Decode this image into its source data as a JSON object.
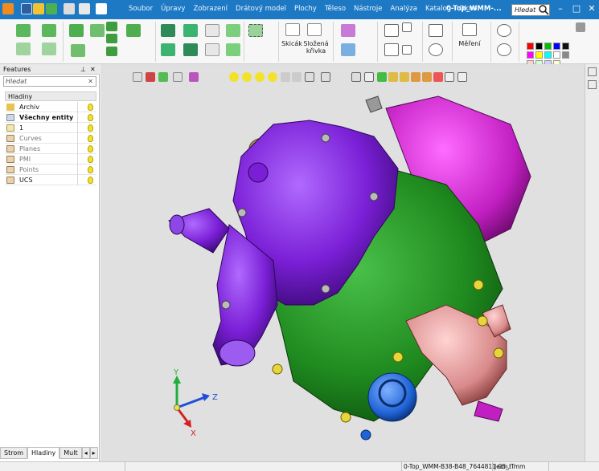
{
  "titlebar": {
    "menu": [
      "Soubor",
      "Úpravy",
      "Zobrazení",
      "Drátový model",
      "Plochy",
      "Těleso",
      "Nástroje",
      "Analýza",
      "Katalog",
      "Okno"
    ],
    "document_title": "0-Top_WMM-...",
    "search_placeholder": "Hledat"
  },
  "ribbon": {
    "sketch_label": "Skicák",
    "composite_curve_label": "Složená\nkřivka",
    "measure_label": "Měření"
  },
  "features_panel": {
    "title": "Features",
    "pin_icon": "pin-icon",
    "close_icon": "close-icon",
    "search_placeholder": "Hledat",
    "layers_header": "Hladiny",
    "layers": [
      {
        "label": "Archiv",
        "icon": "folder-icon"
      },
      {
        "label": "Všechny entity",
        "icon": "all-entities-icon",
        "bold": true
      },
      {
        "label": "1",
        "icon": "layer-icon"
      },
      {
        "label": "Curves",
        "icon": "layer-group-icon"
      },
      {
        "label": "Planes",
        "icon": "layer-group-icon"
      },
      {
        "label": "PMI",
        "icon": "layer-group-icon"
      },
      {
        "label": "Points",
        "icon": "layer-group-icon"
      },
      {
        "label": "UCS",
        "icon": "layer-group-icon"
      }
    ],
    "tabs": [
      "Strom",
      "Hladiny",
      "Mult"
    ],
    "active_tab": "Hladiny"
  },
  "viewport": {
    "axes": {
      "x": "X",
      "y": "Y",
      "z": "Z"
    }
  },
  "statusbar": {
    "file": "0-Top_WMM-B38-B48_7644811-05_IT",
    "units": "Jedn.: mm"
  },
  "colors": {
    "titlebar": "#1d79c4",
    "part_purple": "#7a1fd6",
    "part_green": "#1f8a1f",
    "part_magenta": "#c21fc2",
    "part_pink": "#d98a8a",
    "part_blue": "#1f63d6"
  }
}
